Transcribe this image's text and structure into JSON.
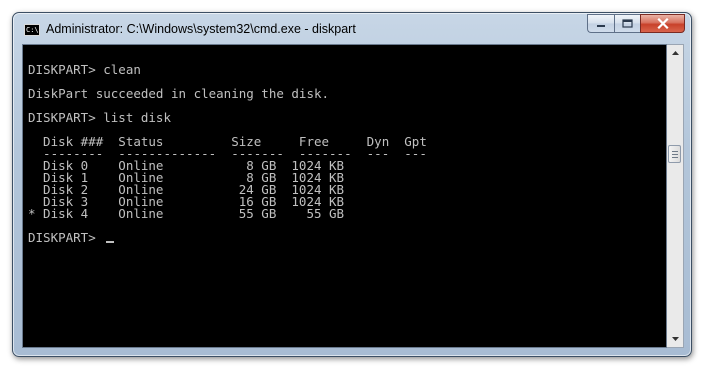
{
  "window": {
    "title": "Administrator: C:\\Windows\\system32\\cmd.exe - diskpart",
    "icon_text": "C:\\"
  },
  "controls": {
    "minimize": "minimize-icon",
    "maximize": "maximize-icon",
    "close": "close-icon"
  },
  "console": {
    "lines": [
      "DISKPART> clean",
      "DiskPart succeeded in cleaning the disk.",
      "DISKPART> list disk",
      "  Disk ###  Status         Size     Free     Dyn  Gpt",
      "  --------  -------------  -------  -------  ---  ---",
      "  Disk 0    Online           8 GB  1024 KB",
      "  Disk 1    Online           8 GB  1024 KB",
      "  Disk 2    Online          24 GB  1024 KB",
      "  Disk 3    Online          16 GB  1024 KB",
      "* Disk 4    Online          55 GB    55 GB",
      "DISKPART> "
    ]
  },
  "colors": {
    "console_bg": "#000000",
    "console_fg": "#c0c0c0",
    "close_button": "#c8412a"
  }
}
